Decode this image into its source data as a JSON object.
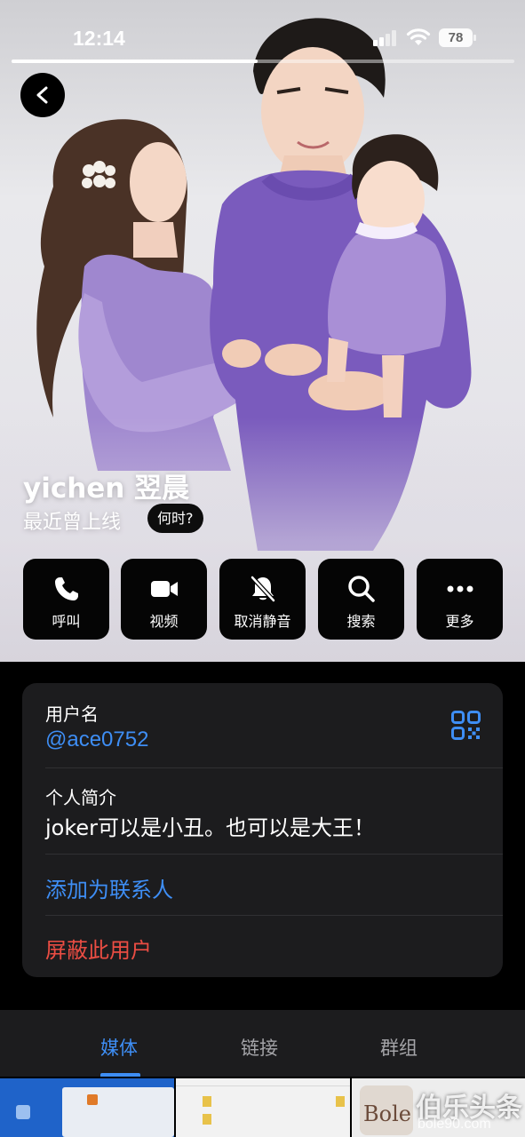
{
  "status_bar": {
    "time": "12:14",
    "battery": "78",
    "story_progress_percent": 49
  },
  "profile": {
    "name": "yichen 翌晨",
    "last_seen": "最近曾上线",
    "when_button": "何时?"
  },
  "actions": [
    {
      "label": "呼叫",
      "icon": "phone-icon"
    },
    {
      "label": "视频",
      "icon": "video-camera-icon"
    },
    {
      "label": "取消静音",
      "icon": "bell-slash-icon"
    },
    {
      "label": "搜索",
      "icon": "search-icon"
    },
    {
      "label": "更多",
      "icon": "more-dots-icon"
    }
  ],
  "info": {
    "username_label": "用户名",
    "username": "@ace0752",
    "bio_label": "个人简介",
    "bio": "joker可以是小丑。也可以是大王！",
    "add_contact": "添加为联系人",
    "block_user": "屏蔽此用户"
  },
  "tabs": [
    {
      "label": "媒体",
      "active": true
    },
    {
      "label": "链接",
      "active": false
    },
    {
      "label": "群组",
      "active": false
    }
  ],
  "watermark": {
    "text": "伯乐头条",
    "url": "bole90.com",
    "logo_text": "Bole"
  },
  "colors": {
    "accent": "#3e8ef5",
    "destructive": "#eb4d43",
    "card": "#1c1c1e",
    "sweater": "#7a5bbd"
  }
}
